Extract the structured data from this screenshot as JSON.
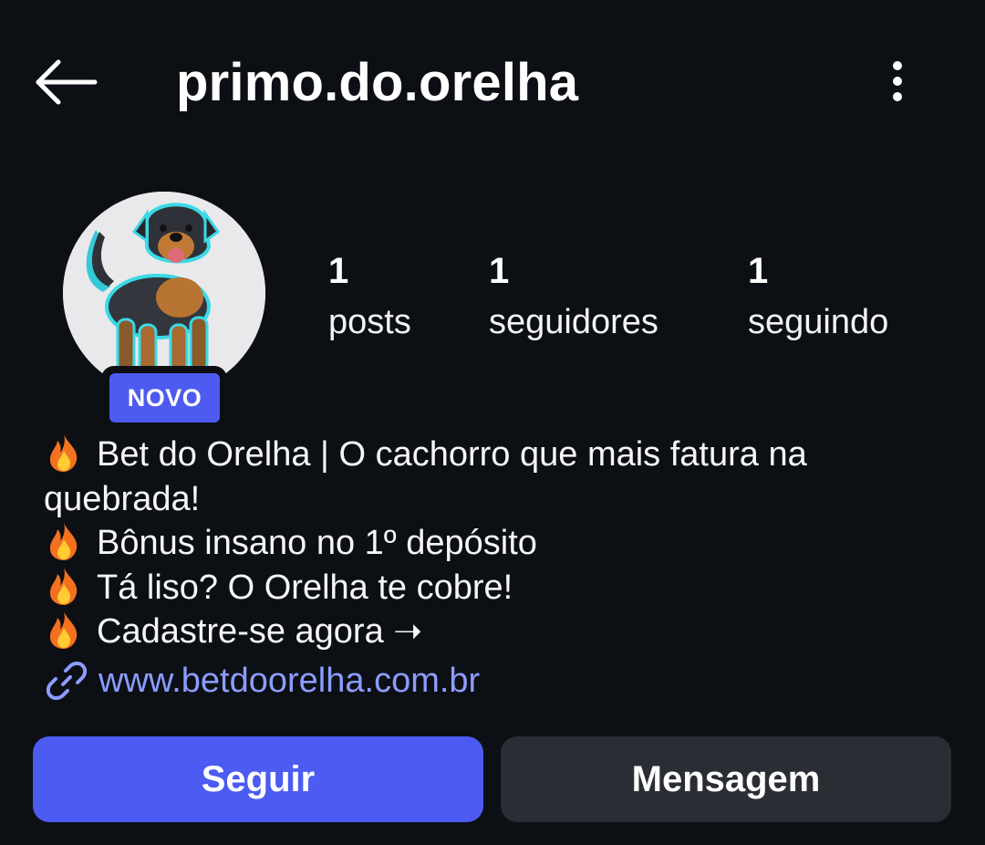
{
  "header": {
    "username": "primo.do.orelha",
    "back_icon": "arrow-left-icon",
    "more_icon": "more-vertical-icon"
  },
  "profile": {
    "avatar": "dog-avatar",
    "badge": "NOVO",
    "stats": {
      "posts": {
        "count": "1",
        "label": "posts"
      },
      "followers": {
        "count": "1",
        "label": "seguidores"
      },
      "following": {
        "count": "1",
        "label": "seguindo"
      }
    }
  },
  "bio": {
    "lines": [
      "Bet do Orelha | O cachorro que mais fatura na quebrada!",
      "Bônus insano no 1º depósito",
      "Tá liso? O Orelha te cobre!",
      "Cadastre-se agora ➝"
    ],
    "line_icon": "fire-emoji-icon",
    "link": "www.betdoorelha.com.br"
  },
  "actions": {
    "follow": "Seguir",
    "message": "Mensagem"
  },
  "colors": {
    "background": "#0c0f14",
    "accent": "#4c5bf2",
    "link": "#8b9dff",
    "secondary_button": "#2a2d33"
  }
}
